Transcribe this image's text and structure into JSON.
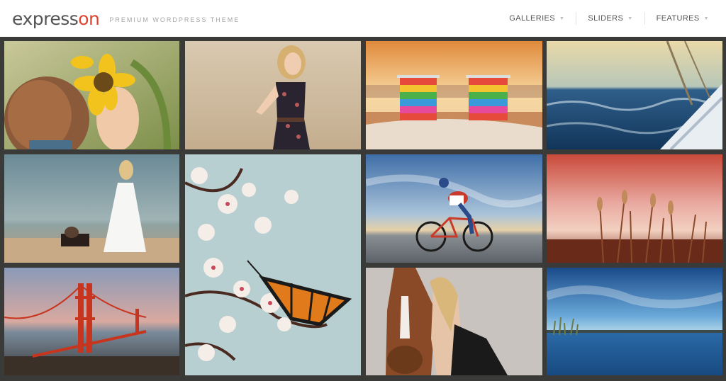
{
  "header": {
    "logo_main": "express",
    "logo_accent": "on",
    "tagline": "PREMIUM WORDPRESS THEME"
  },
  "nav": {
    "items": [
      {
        "label": "GALLERIES"
      },
      {
        "label": "SLIDERS"
      },
      {
        "label": "FEATURES"
      }
    ]
  },
  "icons": {
    "dropdown": "chevron-down-icon"
  },
  "colors": {
    "accent": "#e0442f",
    "background": "#3a3a38"
  },
  "gallery": {
    "photos": [
      "girl-sunflower",
      "woman-floral-dress",
      "beach-chairs",
      "sailboat-ocean",
      "woman-white-dress-beach",
      "cherry-blossom-butterfly",
      "cyclist",
      "red-sunset-grass",
      "golden-gate-bridge",
      "woman-horse",
      "blue-lake-sky"
    ]
  }
}
